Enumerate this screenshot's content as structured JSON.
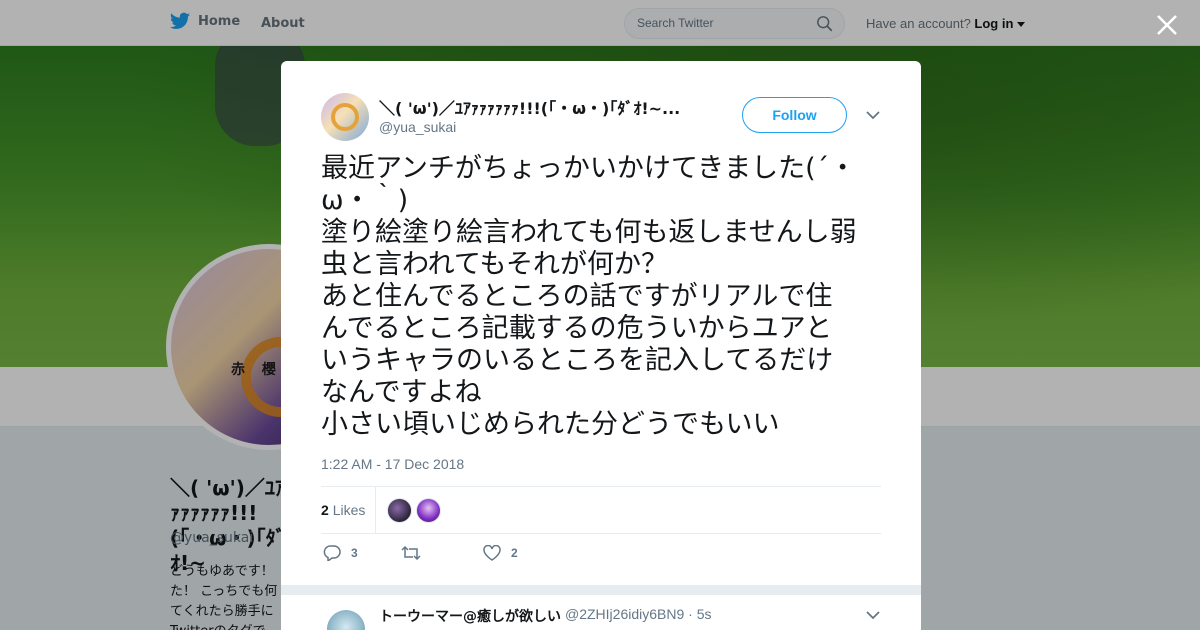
{
  "topbar": {
    "home_label": "Home",
    "about_label": "About",
    "search_placeholder": "Search Twitter",
    "have_account": "Have an account?",
    "login_label": "Log in"
  },
  "background_profile": {
    "name": "＼( 'ω')／ﾕｱｧｧｧｧｧｧ!!!(｢・ω・)｢ﾀﾞｵ!~",
    "handle": "@yua_sukai",
    "bio": "どうもゆあです！ た！ こっちでも何 てくれたら勝手に Twitterのタグで"
  },
  "tweet": {
    "author_name": "＼( 'ω')／ﾕｱｧｧｧｧｧｧ!!!(｢・ω・)｢ﾀﾞｵ!~...",
    "author_handle": "@yua_sukai",
    "follow_label": "Follow",
    "text_lines": [
      "最近アンチがちょっかいかけてきました(´・",
      "ω・｀)",
      "塗り絵塗り絵言われても何も返しませんし弱",
      "虫と言われてもそれが何か？",
      "あと住んでるところの話ですがリアルで住",
      "んでるところ記載するの危ういからユアと",
      "いうキャラのいるところを記入してるだけ",
      "なんですよね",
      "小さい頃いじめられた分どうでもいい"
    ],
    "timestamp": "1:22 AM - 17 Dec 2018",
    "likes_count": "2",
    "likes_label": "Likes",
    "reply_count": "3",
    "like_count": "2"
  },
  "reply": {
    "name": "トーウーマー@癒しが欲しい",
    "meta": "@2ZHIj26idiy6BN9 · 5s"
  },
  "colors": {
    "accent": "#1da1f2",
    "text": "#14171a",
    "muted": "#657786"
  }
}
